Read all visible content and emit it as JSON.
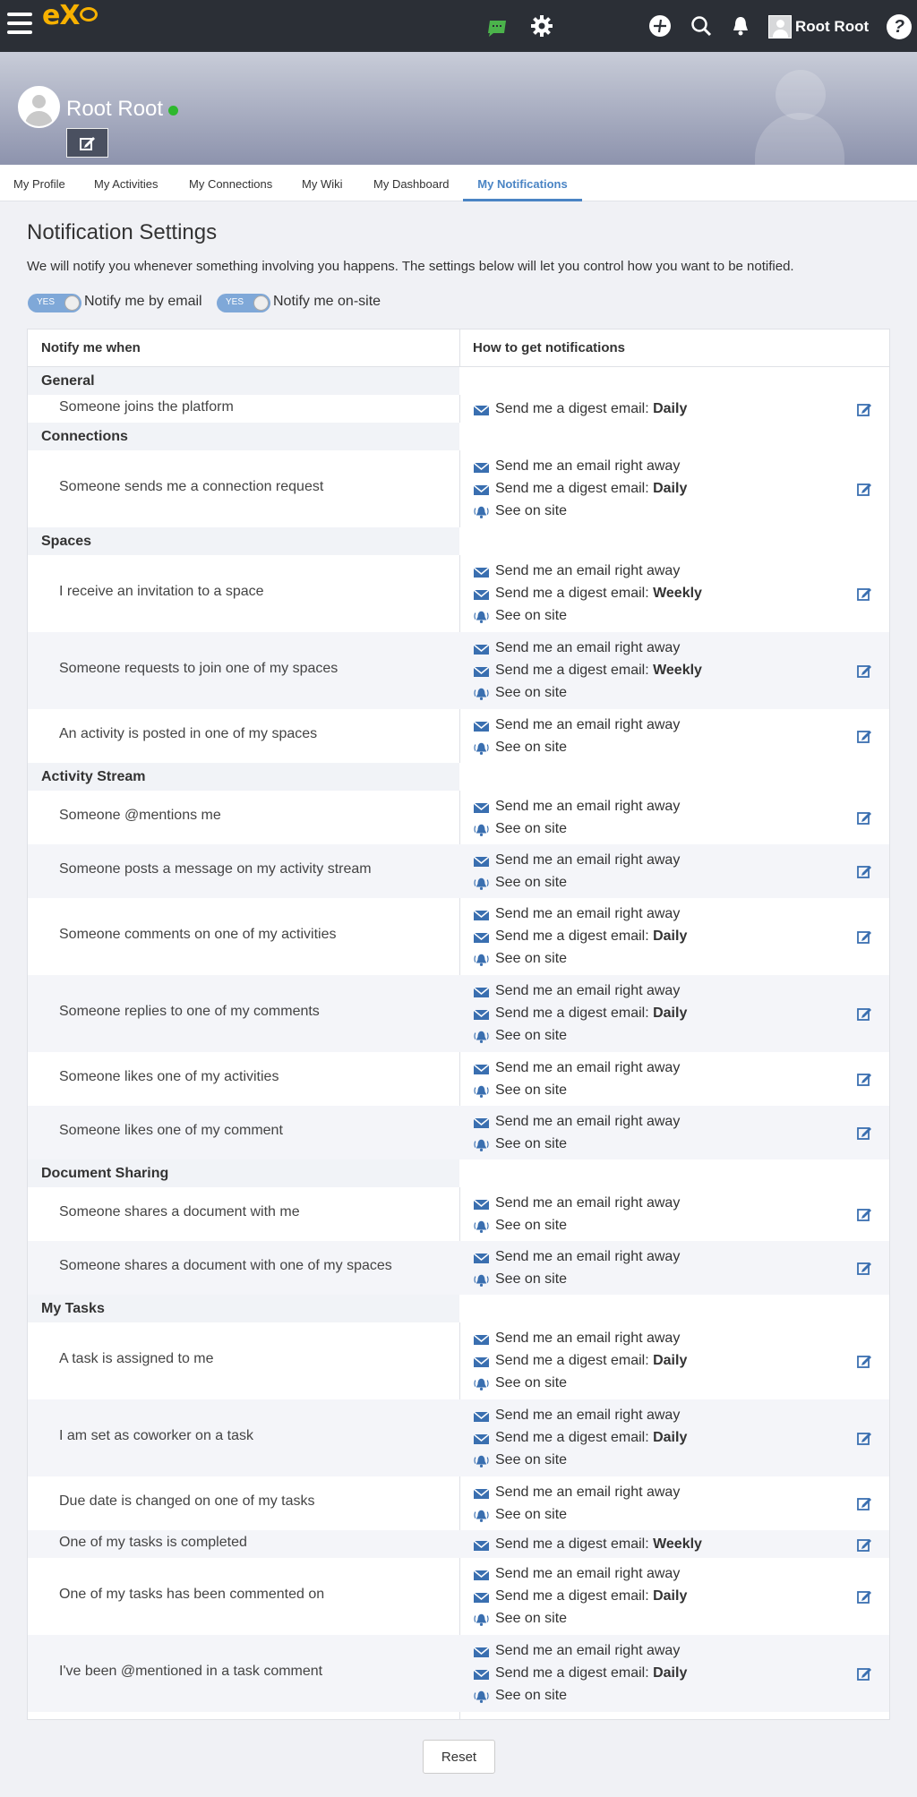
{
  "topbar": {
    "logo": "eXo",
    "user_name": "Root Root",
    "help_label": "?"
  },
  "profile": {
    "name": "Root Root"
  },
  "tabs": [
    {
      "label": "My Profile"
    },
    {
      "label": "My Activities"
    },
    {
      "label": "My Connections"
    },
    {
      "label": "My Wiki"
    },
    {
      "label": "My Dashboard"
    },
    {
      "label": "My Notifications"
    }
  ],
  "page": {
    "title": "Notification Settings",
    "description": "We will notify you whenever something involving you happens. The settings below will let you control how you want to be notified.",
    "email_toggle": {
      "state": "YES",
      "label": "Notify me by email"
    },
    "site_toggle": {
      "state": "YES",
      "label": "Notify me on-site"
    }
  },
  "table": {
    "col1": "Notify me when",
    "col2": "How to get notifications",
    "email_now": "Send me an email right away",
    "digest": "Send me a digest email:",
    "see_site": "See on site",
    "groups": [
      {
        "name": "General",
        "rows": [
          {
            "label": "Someone joins the platform",
            "digest": "Daily"
          }
        ]
      },
      {
        "name": "Connections",
        "rows": [
          {
            "label": "Someone sends me a connection request",
            "digest": "Daily"
          }
        ]
      },
      {
        "name": "Spaces",
        "rows": [
          {
            "label": "I receive an invitation to a space",
            "digest": "Weekly"
          },
          {
            "label": "Someone requests to join one of my spaces",
            "digest": "Weekly"
          },
          {
            "label": "An activity is posted in one of my spaces"
          }
        ]
      },
      {
        "name": "Activity Stream",
        "rows": [
          {
            "label": "Someone @mentions me"
          },
          {
            "label": "Someone posts a message on my activity stream"
          },
          {
            "label": "Someone comments on one of my activities",
            "digest": "Daily"
          },
          {
            "label": "Someone replies to one of my comments",
            "digest": "Daily"
          },
          {
            "label": "Someone likes one of my activities"
          },
          {
            "label": "Someone likes one of my comment"
          }
        ]
      },
      {
        "name": "Document Sharing",
        "rows": [
          {
            "label": "Someone shares a document with me"
          },
          {
            "label": "Someone shares a document with one of my spaces"
          }
        ]
      },
      {
        "name": "My Tasks",
        "rows": [
          {
            "label": "A task is assigned to me",
            "digest": "Daily"
          },
          {
            "label": "I am set as coworker on a task",
            "digest": "Daily"
          },
          {
            "label": "Due date is changed on one of my tasks"
          },
          {
            "label": "One of my tasks is completed",
            "digest": "Weekly"
          },
          {
            "label": "One of my tasks has been commented on",
            "digest": "Daily"
          },
          {
            "label": "I've been @mentioned in a task comment",
            "digest": "Daily"
          }
        ]
      }
    ]
  },
  "reset_label": "Reset",
  "icons": {
    "email": "envelope-icon",
    "site": "bell-icon",
    "edit": "edit-icon"
  },
  "colors": {
    "accent": "#4a84c4",
    "topbar": "#2b2f36",
    "logo": "#f7b100",
    "online": "#2eb82e"
  }
}
